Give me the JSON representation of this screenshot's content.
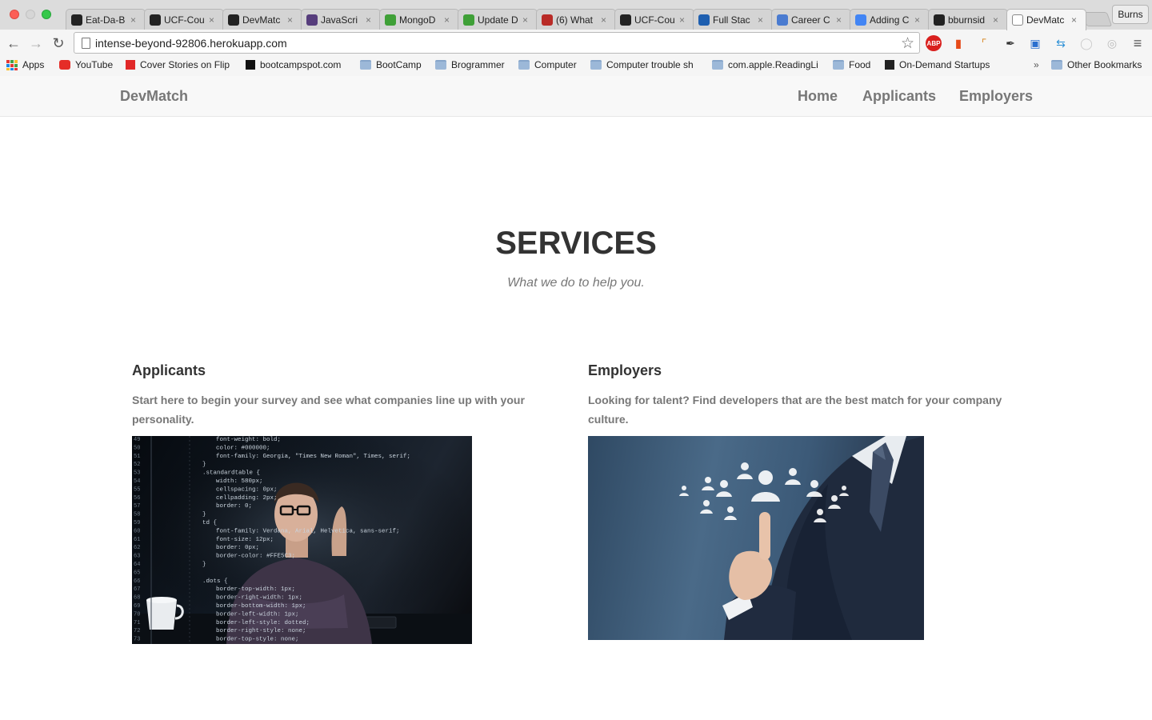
{
  "browser": {
    "tabs": [
      {
        "label": "Eat-Da-B",
        "icon": "github-icon"
      },
      {
        "label": "UCF-Cou",
        "icon": "github-icon"
      },
      {
        "label": "DevMatc",
        "icon": "github-icon"
      },
      {
        "label": "JavaScri",
        "icon": "bootstrap-icon"
      },
      {
        "label": "MongoD",
        "icon": "mongodb-icon"
      },
      {
        "label": "Update D",
        "icon": "mongodb-icon"
      },
      {
        "label": "(6) What",
        "icon": "quora-icon"
      },
      {
        "label": "UCF-Cou",
        "icon": "github-icon"
      },
      {
        "label": "Full Stac",
        "icon": "info-icon"
      },
      {
        "label": "Career C",
        "icon": "career-icon"
      },
      {
        "label": "Adding C",
        "icon": "google-icon"
      },
      {
        "label": "bburnsid",
        "icon": "github-icon"
      },
      {
        "label": "DevMatc",
        "icon": "page-icon",
        "active": true
      }
    ],
    "profile_name": "Burns",
    "url": "intense-beyond-92806.herokuapp.com",
    "bookmarks": [
      {
        "label": "Apps",
        "icon": "apps-icon"
      },
      {
        "label": "YouTube",
        "icon": "youtube-icon"
      },
      {
        "label": "Cover Stories on Flip",
        "icon": "flipboard-icon"
      },
      {
        "label": "bootcampspot.com",
        "icon": "bootcamp-icon"
      },
      {
        "label": "BootCamp",
        "icon": "folder-icon"
      },
      {
        "label": "Brogrammer",
        "icon": "folder-icon"
      },
      {
        "label": "Computer",
        "icon": "folder-icon"
      },
      {
        "label": "Computer trouble sh",
        "icon": "folder-icon"
      },
      {
        "label": "com.apple.ReadingLi",
        "icon": "folder-icon"
      },
      {
        "label": "Food",
        "icon": "folder-icon"
      },
      {
        "label": "On-Demand Startups",
        "icon": "startup-icon"
      }
    ],
    "overflow_label": "»",
    "other_bookmarks": "Other Bookmarks"
  },
  "site": {
    "brand": "DevMatch",
    "nav": [
      "Home",
      "Applicants",
      "Employers"
    ]
  },
  "services": {
    "title": "SERVICES",
    "subtitle": "What we do to help you."
  },
  "columns": [
    {
      "title": "Applicants",
      "text": "Start here to begin your survey and see what companies line up with your personality."
    },
    {
      "title": "Employers",
      "text": "Looking for talent? Find developers that are the best match for your company culture."
    }
  ],
  "code_lines": [
    "font-weight: bold;",
    "color: #000000;",
    "font-family: Georgia, \"Times New Roman\", Times, serif;",
    "}",
    ".standardtable {",
    "width: 580px;",
    "cellspacing: 0px;",
    "cellpadding: 2px;",
    "border: 0;",
    "}",
    "td {",
    "font-family: Verdana, Arial, Helvetica, sans-serif;",
    "font-size: 12px;",
    "border: 0px;",
    "border-color: #FFE5C3;",
    "}",
    "",
    ".dots {",
    "border-top-width: 1px;",
    "border-right-width: 1px;",
    "border-bottom-width: 1px;",
    "border-left-width: 1px;",
    "border-left-style: dotted;",
    "border-right-style: none;",
    "border-top-style: none;"
  ],
  "line_numbers": [
    "49",
    "50",
    "51",
    "52",
    "53",
    "54",
    "55",
    "56",
    "57",
    "58",
    "59",
    "60",
    "61",
    "62",
    "63",
    "64",
    "65",
    "66",
    "67",
    "68",
    "69",
    "70",
    "71",
    "72",
    "73"
  ]
}
